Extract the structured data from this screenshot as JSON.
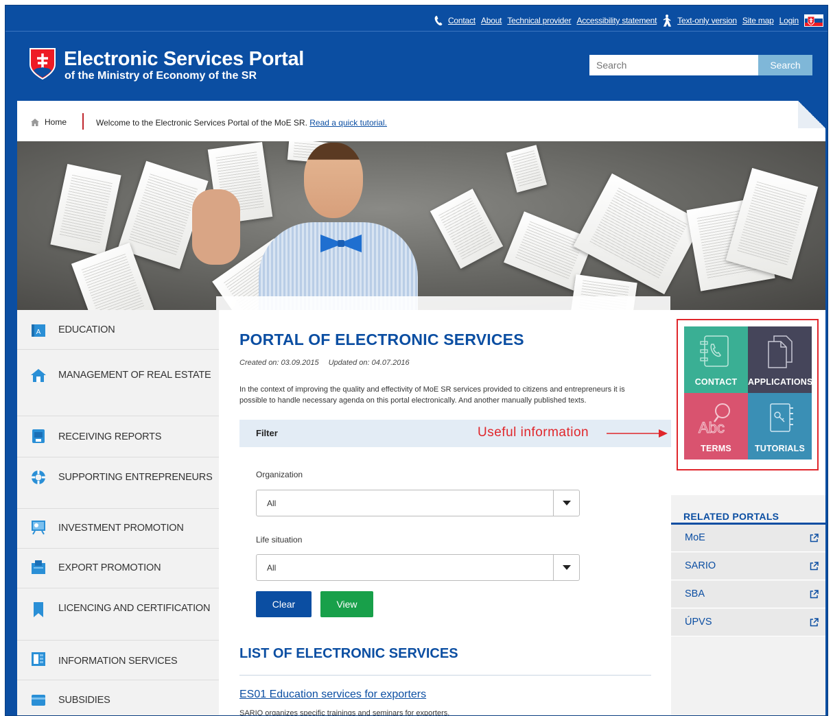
{
  "top_links": {
    "contact": "Contact",
    "about": "About",
    "technical_provider": "Technical provider",
    "accessibility": "Accessibility statement",
    "text_only": "Text-only version",
    "site_map": "Site map",
    "login": "Login"
  },
  "header": {
    "title": "Electronic Services Portal",
    "subtitle": "of the Ministry of Economy of the SR"
  },
  "search": {
    "placeholder": "Search",
    "button_label": "Search"
  },
  "breadcrumb": {
    "home": "Home",
    "welcome_text": "Welcome to the Electronic Services Portal of the MoE SR.",
    "tutorial_link": "Read a quick tutorial."
  },
  "sidebar": {
    "items": [
      {
        "label": "EDUCATION",
        "icon": "education-icon"
      },
      {
        "label": "MANAGEMENT OF REAL ESTATE",
        "icon": "house-icon"
      },
      {
        "label": "RECEIVING REPORTS",
        "icon": "report-icon"
      },
      {
        "label": "SUPPORTING ENTREPRENEURS",
        "icon": "lifebuoy-icon"
      },
      {
        "label": "INVESTMENT PROMOTION",
        "icon": "presentation-icon"
      },
      {
        "label": "EXPORT PROMOTION",
        "icon": "export-icon"
      },
      {
        "label": "LICENCING AND CERTIFICATION",
        "icon": "bookmark-icon"
      },
      {
        "label": "INFORMATION SERVICES",
        "icon": "info-services-icon"
      },
      {
        "label": "SUBSIDIES",
        "icon": "card-icon"
      }
    ]
  },
  "main": {
    "title": "PORTAL OF ELECTRONIC SERVICES",
    "created": "Created on: 03.09.2015",
    "updated": "Updated on: 04.07.2016",
    "intro": "In the context of improving the quality and effectivity of MoE SR services provided to citizens and entrepreneurs it is possible to handle necessary agenda on this portal electronically. And another manually published texts.",
    "filter_label": "Filter",
    "annotation": "Useful information",
    "organization_label": "Organization",
    "organization_value": "All",
    "life_situation_label": "Life situation",
    "life_situation_value": "All",
    "clear_label": "Clear",
    "view_label": "View",
    "list_title": "LIST OF ELECTRONIC SERVICES",
    "service_link": "ES01 Education services for exporters",
    "service_desc": "SARIO organizes specific trainings and seminars for exporters."
  },
  "tiles": {
    "contact": "CONTACT",
    "applications": "APPLICATIONS",
    "terms": "TERMS",
    "tutorials": "TUTORIALS"
  },
  "related_portals": {
    "title": "RELATED PORTALS",
    "items": [
      "MoE",
      "SARIO",
      "SBA",
      "ÚPVS"
    ]
  },
  "colors": {
    "brand_blue": "#0b4ea2",
    "tile_contact": "#3aaf94",
    "tile_applications": "#45455a",
    "tile_terms": "#d9536f",
    "tile_tutorials": "#3a8fb5",
    "annotation_red": "#e0262b",
    "view_green": "#18a04a"
  }
}
